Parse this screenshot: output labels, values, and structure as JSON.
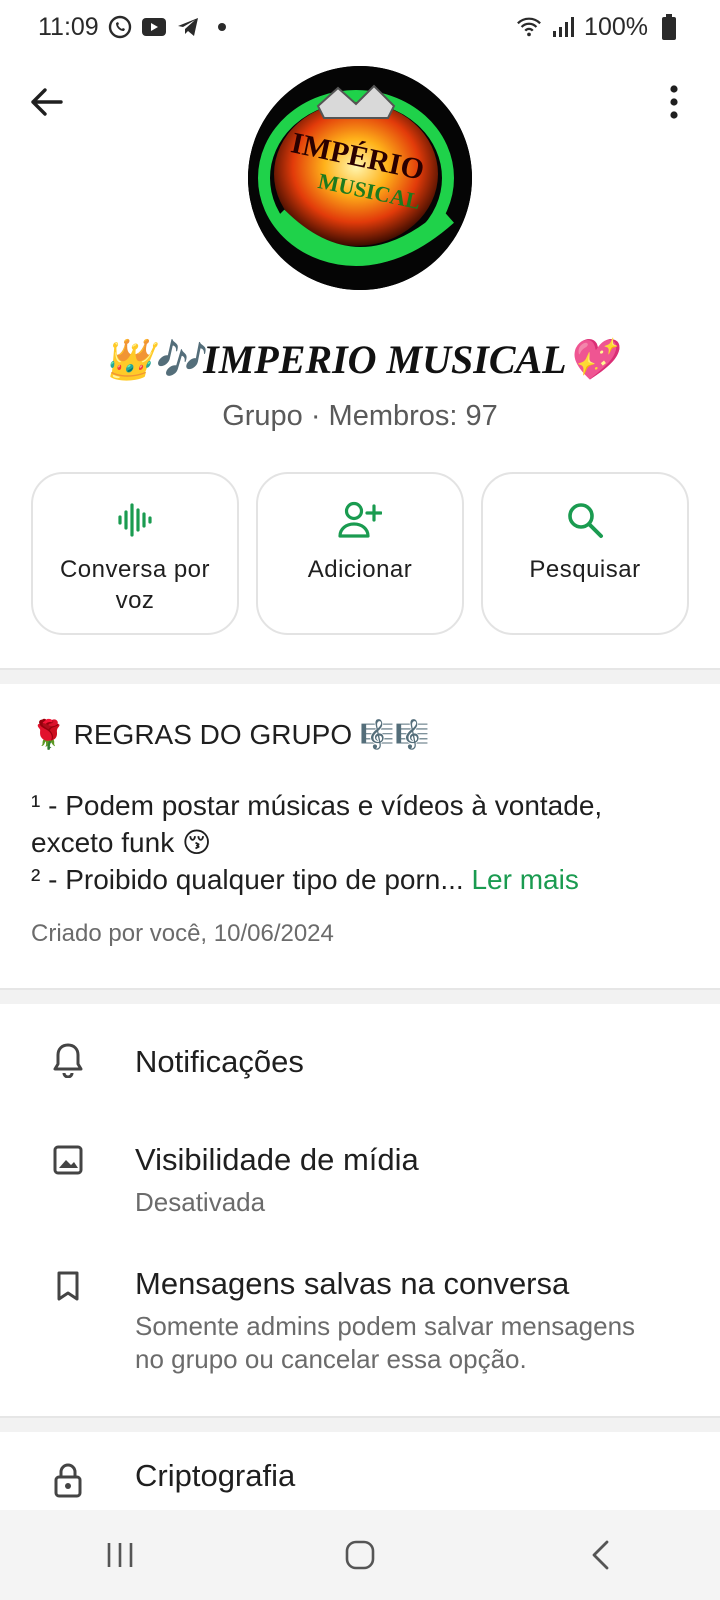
{
  "status_bar": {
    "time": "11:09",
    "battery": "100%",
    "icons": [
      "whatsapp-icon",
      "youtube-icon",
      "telegram-icon",
      "dot-icon",
      "wifi-icon",
      "signal-icon",
      "battery-icon"
    ]
  },
  "header": {
    "back_icon": "arrow-left-icon",
    "menu_icon": "more-vertical-icon"
  },
  "group": {
    "name": "👑🎶IMPERIO MUSICAL💖",
    "subtitle": "Grupo · Membros: 97"
  },
  "actions": [
    {
      "label": "Conversa por voz",
      "icon": "voice-wave-icon"
    },
    {
      "label": "Adicionar",
      "icon": "add-person-icon"
    },
    {
      "label": "Pesquisar",
      "icon": "search-icon"
    }
  ],
  "description": {
    "title": "🌹 REGRAS DO GRUPO 🎼🎼",
    "line1": "¹ - Podem postar músicas e vídeos  à vontade, exceto funk 😚",
    "line2": "² - Proibido qualquer tipo de porn...",
    "read_more": "Ler mais",
    "created": "Criado por você, 10/06/2024"
  },
  "settings": [
    {
      "title": "Notificações",
      "icon": "bell-icon"
    },
    {
      "title": "Visibilidade de mídia",
      "subtitle": "Desativada",
      "icon": "image-icon"
    },
    {
      "title": "Mensagens salvas na conversa",
      "subtitle": "Somente admins podem salvar mensagens no grupo ou cancelar essa opção.",
      "icon": "bookmark-icon"
    },
    {
      "title": "Criptografia",
      "icon": "lock-icon"
    }
  ],
  "colors": {
    "accent": "#1a9b50",
    "text": "#1f1f1f",
    "muted": "#6b6b6b"
  }
}
